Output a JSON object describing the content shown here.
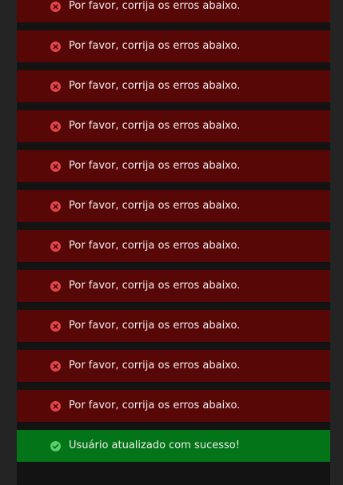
{
  "messages": [
    {
      "type": "error",
      "icon": "error-circle-x-icon",
      "text": "Por favor, corrija os erros abaixo."
    },
    {
      "type": "error",
      "icon": "error-circle-x-icon",
      "text": "Por favor, corrija os erros abaixo."
    },
    {
      "type": "error",
      "icon": "error-circle-x-icon",
      "text": "Por favor, corrija os erros abaixo."
    },
    {
      "type": "error",
      "icon": "error-circle-x-icon",
      "text": "Por favor, corrija os erros abaixo."
    },
    {
      "type": "error",
      "icon": "error-circle-x-icon",
      "text": "Por favor, corrija os erros abaixo."
    },
    {
      "type": "error",
      "icon": "error-circle-x-icon",
      "text": "Por favor, corrija os erros abaixo."
    },
    {
      "type": "error",
      "icon": "error-circle-x-icon",
      "text": "Por favor, corrija os erros abaixo."
    },
    {
      "type": "error",
      "icon": "error-circle-x-icon",
      "text": "Por favor, corrija os erros abaixo."
    },
    {
      "type": "error",
      "icon": "error-circle-x-icon",
      "text": "Por favor, corrija os erros abaixo."
    },
    {
      "type": "error",
      "icon": "error-circle-x-icon",
      "text": "Por favor, corrija os erros abaixo."
    },
    {
      "type": "error",
      "icon": "error-circle-x-icon",
      "text": "Por favor, corrija os erros abaixo."
    },
    {
      "type": "success",
      "icon": "success-circle-check-icon",
      "text": "Usuário atualizado com sucesso!"
    }
  ],
  "colors": {
    "page_background": "#242424",
    "content_background": "#131313",
    "error_background": "#580707",
    "error_icon": "#e0474c",
    "success_background": "#037418",
    "success_icon": "#58d06a",
    "message_text": "#f1eded"
  }
}
